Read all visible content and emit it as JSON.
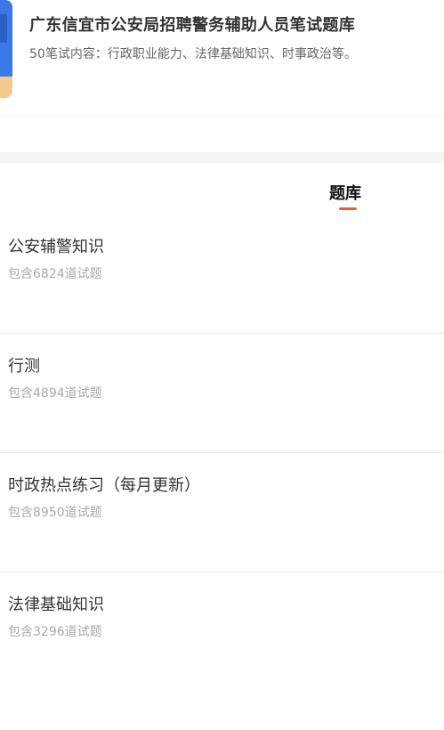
{
  "header": {
    "title": "广东信宜市公安局招聘警务辅助人员笔试题库",
    "description": "50笔试内容：行政职业能力、法律基础知识、时事政治等。"
  },
  "tabs": [
    {
      "label": "题库",
      "active": true
    }
  ],
  "colors": {
    "accent": "#e0623e",
    "cover_blue": "#3b79e6",
    "cover_tan": "#f2c98e"
  },
  "question_banks": [
    {
      "name": "公安辅警知识",
      "count_text": "包含6824道试题"
    },
    {
      "name": "行测",
      "count_text": "包含4894道试题"
    },
    {
      "name": "时政热点练习（每月更新）",
      "count_text": "包含8950道试题"
    },
    {
      "name": "法律基础知识",
      "count_text": "包含3296道试题"
    }
  ]
}
